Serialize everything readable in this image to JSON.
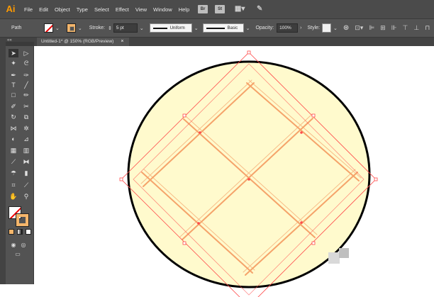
{
  "app": {
    "logo": "Ai"
  },
  "menu": [
    "File",
    "Edit",
    "Object",
    "Type",
    "Select",
    "Effect",
    "View",
    "Window",
    "Help"
  ],
  "menubar_icons": {
    "bridge": "Br",
    "stock": "St",
    "workspace": "workspace-grid-icon",
    "brush": "brush-icon"
  },
  "control": {
    "selection_label": "Path",
    "stroke_label": "Stroke:",
    "stroke_weight": "5 pt",
    "profile": "Uniform",
    "brush": "Basic",
    "opacity_label": "Opacity:",
    "opacity_value": "100%",
    "style_label": "Style:",
    "fill_color": "none",
    "stroke_color": "#f5b66b"
  },
  "document": {
    "tab_title": "Untitled-1* @ 150% (RGB/Preview)",
    "close_glyph": "×"
  },
  "tools_panel": {
    "collapse_glyph": "««",
    "fill": "none",
    "stroke": "#f5b66b"
  },
  "artwork": {
    "circle_fill": "#fffacd",
    "circle_stroke": "#000000",
    "grid_stroke": "#f5a36a",
    "selection_color": "#ff4b4b"
  }
}
